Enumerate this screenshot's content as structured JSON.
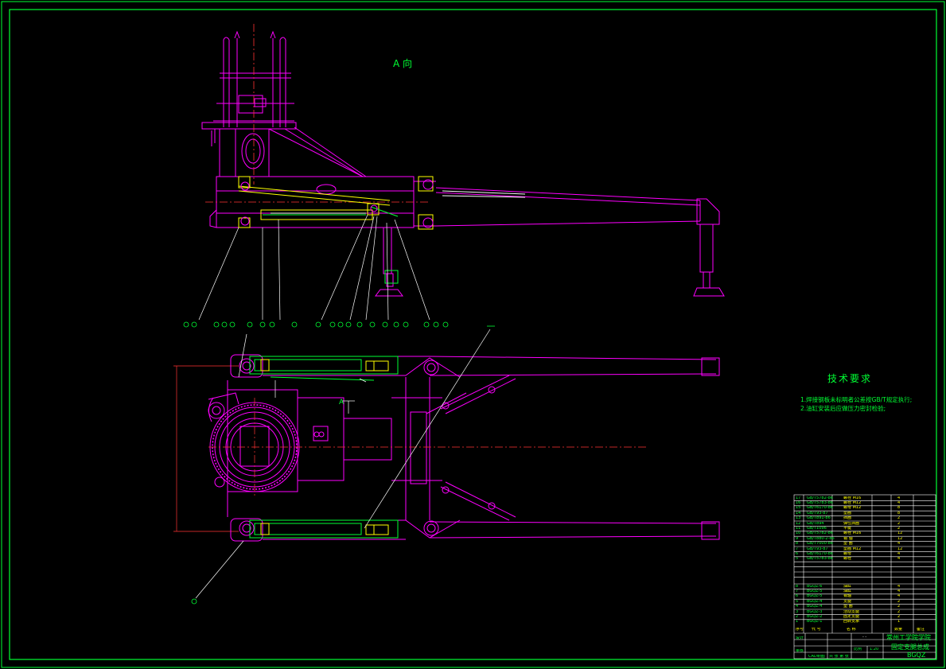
{
  "colors": {
    "background": "#000000",
    "primary": "#ff00ff",
    "secondary": "#00ff33",
    "highlight": "#ffff00",
    "lines": "#ffffff",
    "center": "#ff3333"
  },
  "views": {
    "section_a_label": "A 向",
    "plan_marker": "A"
  },
  "technical_requirements": {
    "title": "技术要求",
    "notes": [
      "1.焊接钢板未标明者公差按GB/T规定执行;",
      "2.油缸安装后应做压力密封检验;"
    ]
  },
  "parts_list": {
    "standard_parts": [
      {
        "no": "17",
        "code": "GB/T5782-86",
        "name": "螺栓 M16",
        "qty": "4"
      },
      {
        "no": "16",
        "code": "GB/T5783-86",
        "name": "螺栓 M12",
        "qty": "4"
      },
      {
        "no": "15",
        "code": "GB/T6170-86",
        "name": "螺母 M12",
        "qty": "8"
      },
      {
        "no": "14",
        "code": "GB/T93-87",
        "name": "垫圈",
        "qty": "8"
      },
      {
        "no": "13",
        "code": "GB/T891-86",
        "name": "挡圈",
        "qty": "2"
      },
      {
        "no": "12",
        "code": "GB/T894",
        "name": "弹性挡圈",
        "qty": "2"
      },
      {
        "no": "11",
        "code": "GB/T1096",
        "name": "平键",
        "qty": "2"
      },
      {
        "no": "10",
        "code": "GB/T5782-86",
        "name": "螺栓 M16",
        "qty": "12"
      },
      {
        "no": "9",
        "code": "GB/T880-2-86",
        "name": "销 轴",
        "qty": "12"
      },
      {
        "no": "8",
        "code": "GB/T7000-86",
        "name": "垫 圈",
        "qty": "4"
      },
      {
        "no": "7",
        "code": "GB/T93-87",
        "name": "垫圈 M12",
        "qty": "12"
      },
      {
        "no": "6",
        "code": "GB/T6170-86",
        "name": "螺母",
        "qty": "4"
      },
      {
        "no": "5",
        "code": "GB/T5783-86",
        "name": "螺栓",
        "qty": "4"
      }
    ],
    "custom_parts": [
      {
        "no": "8",
        "code": "BGQZ-6",
        "name": "油缸",
        "qty": "4"
      },
      {
        "no": "7",
        "code": "BGQZ-5",
        "name": "油缸",
        "qty": "4"
      },
      {
        "no": "6",
        "code": "BGQZ-5",
        "name": "销轴",
        "qty": "4"
      },
      {
        "no": "5",
        "code": "BGQZ-4",
        "name": "支腿",
        "qty": "2"
      },
      {
        "no": "4",
        "code": "BGQZ-4",
        "name": "垫 圈",
        "qty": "2"
      },
      {
        "no": "3",
        "code": "BGQZ-3",
        "name": "活动支腿",
        "qty": "2"
      },
      {
        "no": "2",
        "code": "BGQZ-2",
        "name": "固定支腿",
        "qty": "2"
      },
      {
        "no": "1",
        "code": "BGQZ-1",
        "name": "回转支承",
        "qty": "1"
      }
    ],
    "header": {
      "no": "序号",
      "code": "代 号",
      "name": "名 称",
      "qty": "数量",
      "note": "备注"
    }
  },
  "title_block": {
    "school": "常州工学院学院",
    "drawing_name": "固定支腿总成",
    "drawing_no": "BGQZ",
    "scale": "1:20",
    "scale_label": "比例",
    "designer_label": "设计",
    "checker_label": "审核",
    "dash": "- -",
    "sheet_label": "共 张 第 张",
    "cad_mark": "CAD制图"
  }
}
